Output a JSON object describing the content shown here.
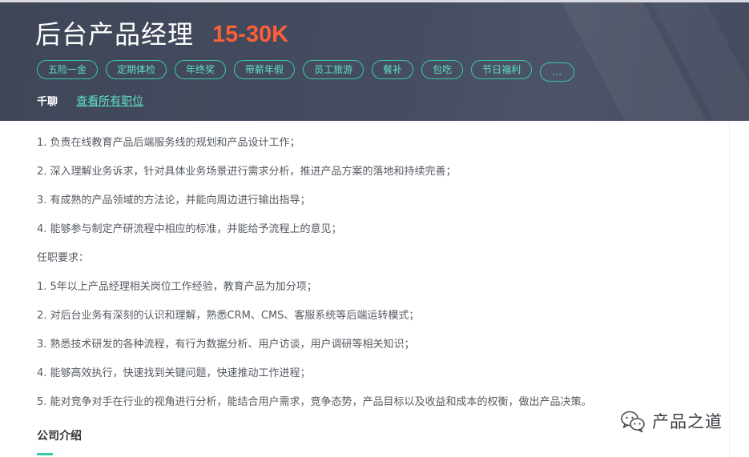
{
  "header": {
    "job_title": "后台产品经理",
    "salary": "15-30K",
    "tags": [
      "五险一金",
      "定期体检",
      "年终奖",
      "带薪年假",
      "员工旅游",
      "餐补",
      "包吃",
      "节日福利"
    ],
    "more_tag": "…",
    "company_name": "千聊",
    "view_all_jobs": "查看所有职位"
  },
  "description": {
    "lines": [
      "1. 负责在线教育产品后端服务线的规划和产品设计工作；",
      "2. 深入理解业务诉求，针对具体业务场景进行需求分析，推进产品方案的落地和持续完善；",
      "3. 有成熟的产品领域的方法论，并能向周边进行输出指导；",
      "4. 能够参与制定产研流程中相应的标准，并能给予流程上的意见；",
      "任职要求：",
      "1. 5年以上产品经理相关岗位工作经验，教育产品为加分项；",
      "2. 对后台业务有深刻的认识和理解，熟悉CRM、CMS、客服系统等后端运转模式；",
      "3. 熟悉技术研发的各种流程，有行为数据分析、用户访谈，用户调研等相关知识；",
      "4. 能够高效执行，快速找到关键问题，快速推动工作进程；",
      "5. 能对竞争对手在行业的视角进行分析，能结合用户需求，竞争态势，产品目标以及收益和成本的权衡，做出产品决策。"
    ]
  },
  "company_section": {
    "title": "公司介绍"
  },
  "watermark": {
    "icon": "wechat-icon",
    "text": "产品之道"
  },
  "colors": {
    "header_bg": "#444b5e",
    "salary": "#fd5f39",
    "accent": "#38c9a7",
    "body_text": "#555a61"
  }
}
